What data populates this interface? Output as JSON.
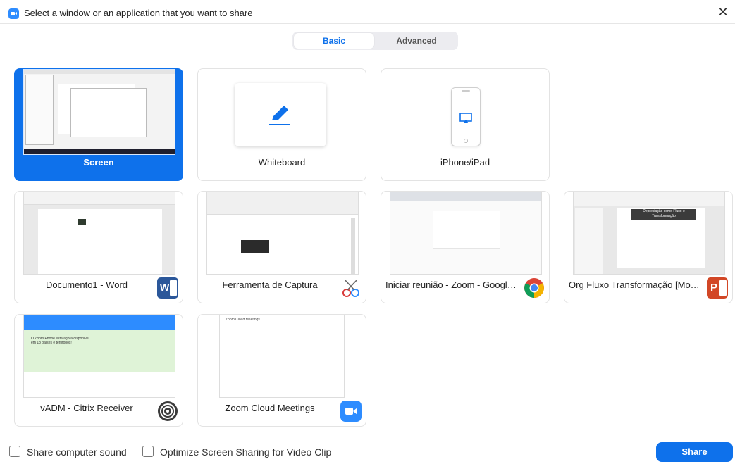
{
  "window": {
    "title": "Select a window or an application that you want to share"
  },
  "tabs": {
    "basic": "Basic",
    "advanced": "Advanced",
    "active": "Basic"
  },
  "cards": [
    {
      "label": "Screen",
      "selected": true
    },
    {
      "label": "Whiteboard"
    },
    {
      "label": "iPhone/iPad"
    },
    {
      "label": "Documento1 - Word",
      "app_icon": "word-icon"
    },
    {
      "label": "Ferramenta de Captura",
      "app_icon": "snipping-tool-icon"
    },
    {
      "label": "Iniciar reunião - Zoom - Google ...",
      "app_icon": "chrome-icon"
    },
    {
      "label": "Org Fluxo Transformação [Modo ...",
      "app_icon": "powerpoint-icon"
    },
    {
      "label": "vADM - Citrix Receiver",
      "app_icon": "citrix-icon"
    },
    {
      "label": "Zoom Cloud Meetings",
      "app_icon": "zoom-icon"
    }
  ],
  "previews": {
    "ppt_slide_title": "Depreciação como Fluxo e Transformação",
    "zoom_banner": "O Zoom Phone está agora disponível em 18 países e territórios!",
    "zoom_window_title": "Zoom Cloud Meetings"
  },
  "footer": {
    "share_sound": "Share computer sound",
    "optimize_video": "Optimize Screen Sharing for Video Clip",
    "share_button": "Share"
  },
  "colors": {
    "accent": "#0e71eb",
    "word": "#2b579a",
    "powerpoint": "#d24726",
    "zoom": "#2d8cff"
  }
}
